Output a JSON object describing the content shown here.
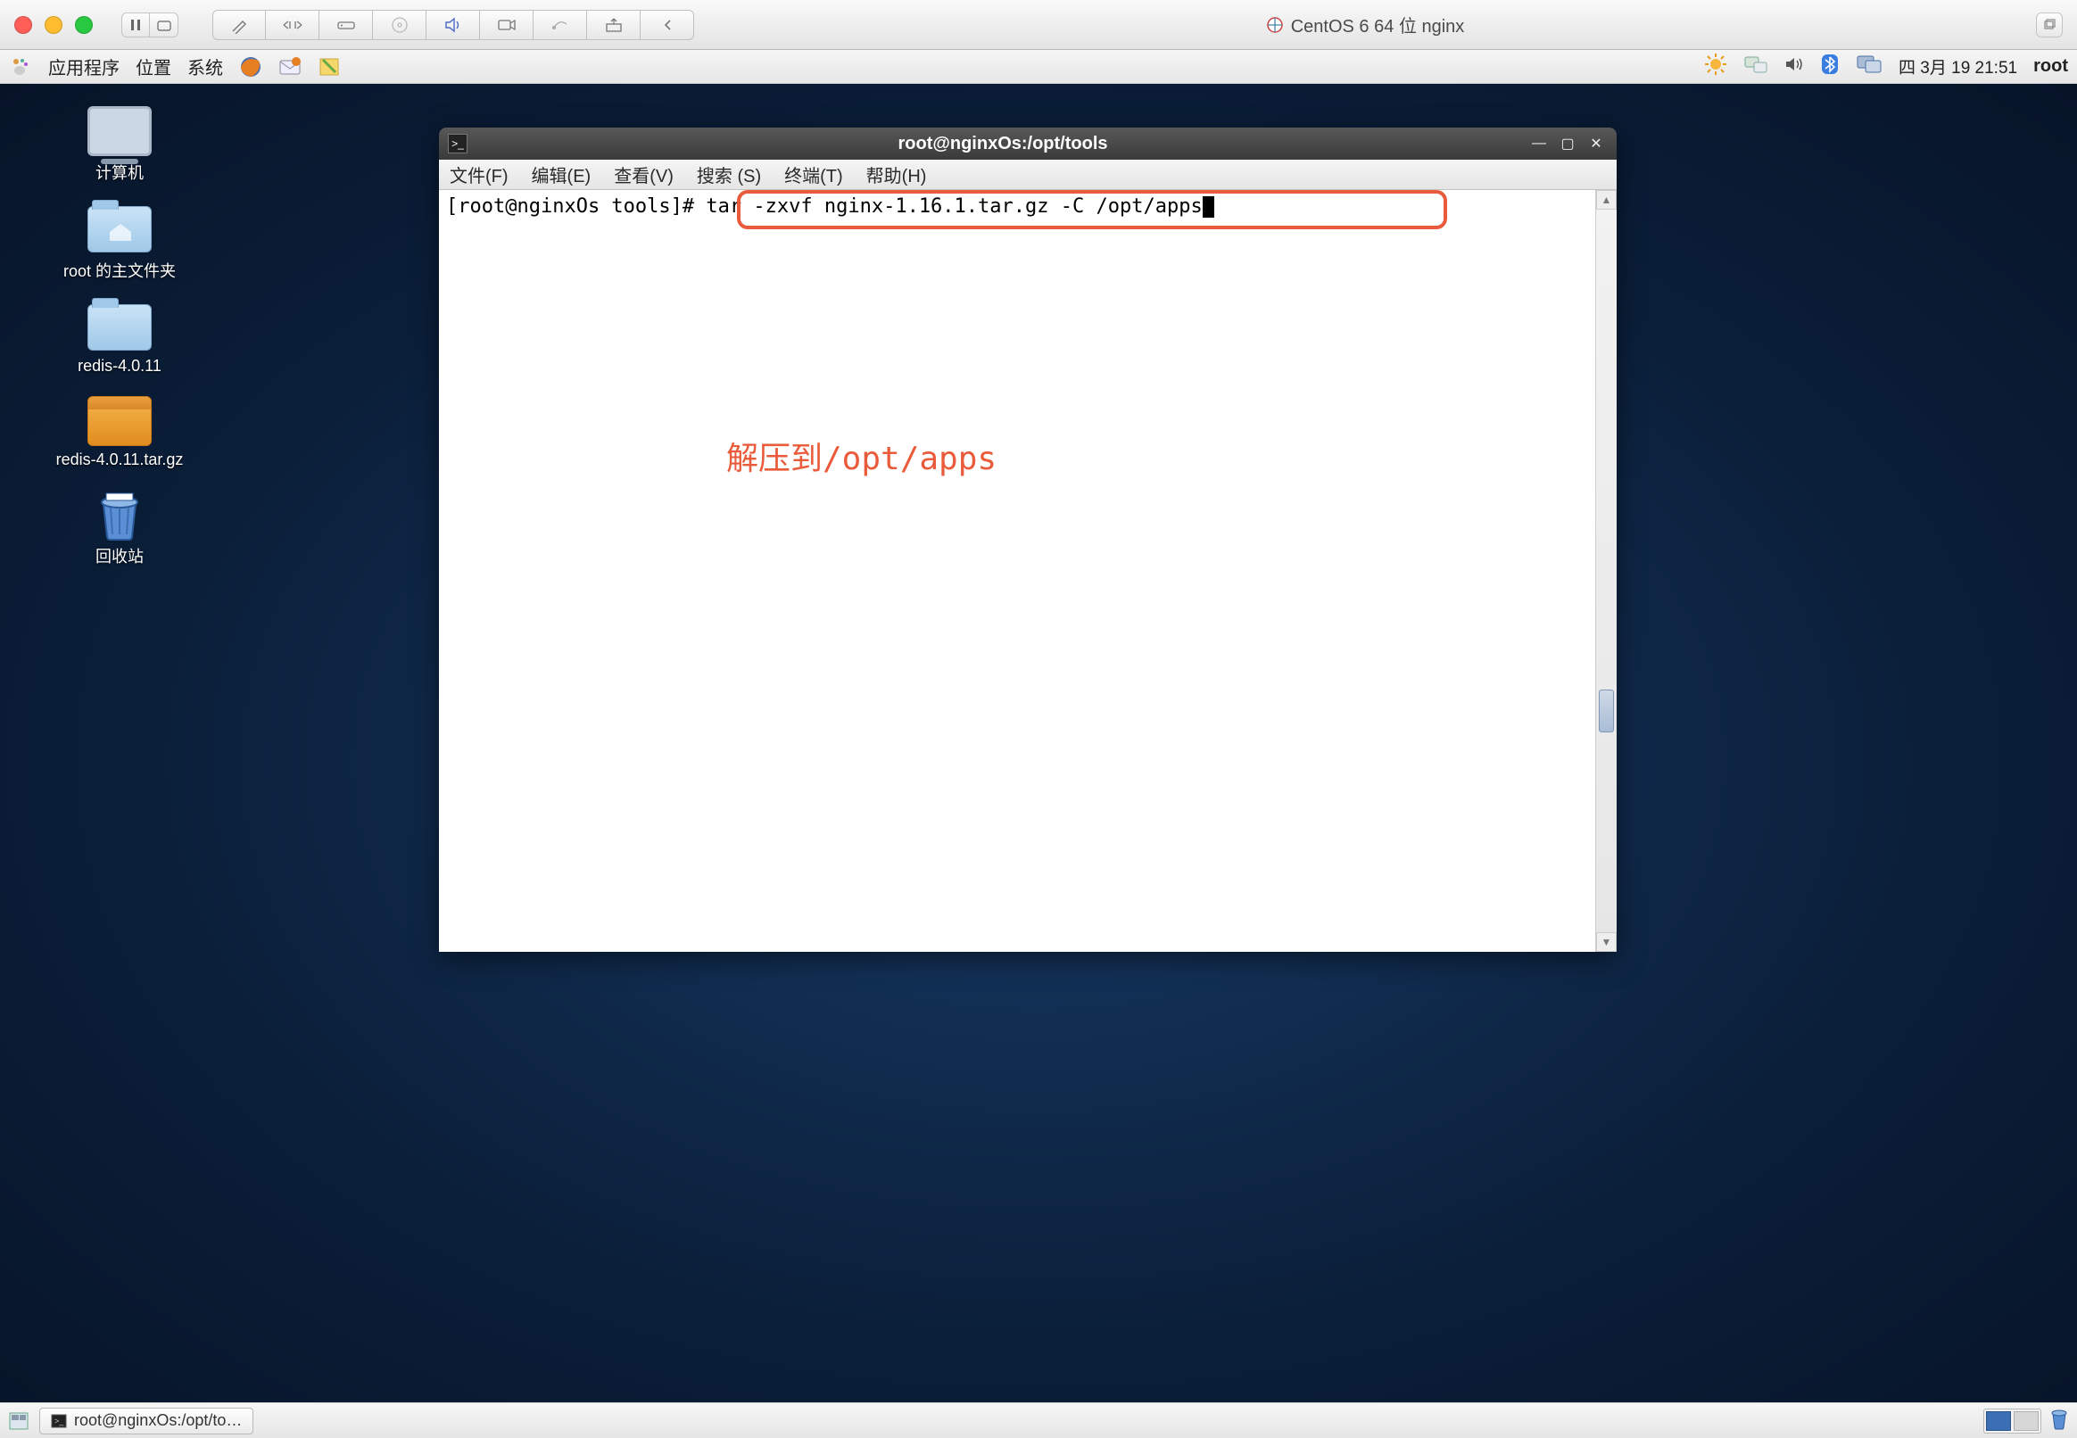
{
  "mac": {
    "vm_title": "CentOS 6 64 位 nginx"
  },
  "gnome": {
    "menus": {
      "apps": "应用程序",
      "places": "位置",
      "system": "系统"
    },
    "clock": "四 3月 19 21:51",
    "user": "root"
  },
  "desktop_icons": {
    "computer": "计算机",
    "home": "root 的主文件夹",
    "redis_dir": "redis-4.0.11",
    "redis_tar": "redis-4.0.11.tar.gz",
    "trash": "回收站"
  },
  "terminal": {
    "title": "root@nginxOs:/opt/tools",
    "menus": {
      "file": "文件(F)",
      "edit": "编辑(E)",
      "view": "查看(V)",
      "search": "搜索 (S)",
      "terminal": "终端(T)",
      "help": "帮助(H)"
    },
    "prompt": "[root@nginxOs tools]#",
    "command": " tar -zxvf nginx-1.16.1.tar.gz -C /opt/apps"
  },
  "annotation": "解压到/opt/apps",
  "taskbar": {
    "active_window": "root@nginxOs:/opt/to…"
  }
}
